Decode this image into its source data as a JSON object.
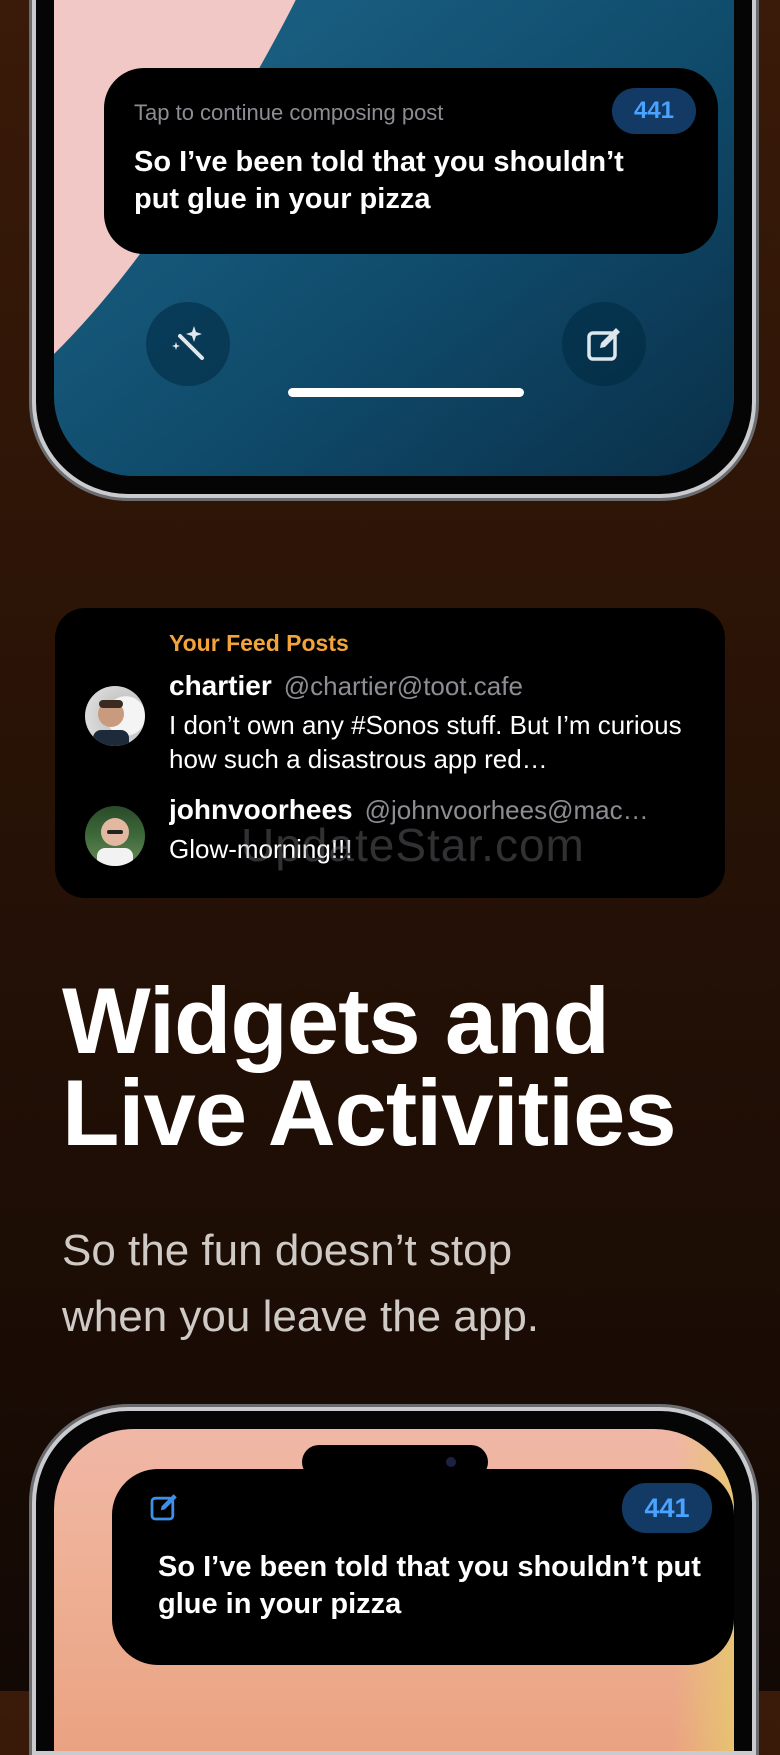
{
  "colors": {
    "background_top": "#3a1a08",
    "background_bottom": "#120804",
    "accent_orange": "#f2a33a",
    "badge_text": "#4aa3ff",
    "badge_bg": "#123a64"
  },
  "live_activity_top": {
    "hint": "Tap to continue composing post",
    "count": "441",
    "text": "So I’ve been told that you shouldn’t put glue in your pizza",
    "left_button_icon": "magic-wand-icon",
    "right_button_icon": "compose-icon"
  },
  "feed_widget": {
    "title": "Your Feed Posts",
    "posts": [
      {
        "name": "chartier",
        "handle": "@chartier@toot.cafe",
        "body": "I don’t own any #Sonos stuff. But I’m curious how such a disastrous app red…"
      },
      {
        "name": "johnvoorhees",
        "handle": "@johnvoorhees@mac…",
        "body": "Glow-morning!!!"
      }
    ],
    "watermark": "UpdateStar.com"
  },
  "headline": {
    "line1": "Widgets and",
    "line2": "Live Activities"
  },
  "subhead": {
    "line1": "So the fun doesn’t stop",
    "line2": "when you leave the app."
  },
  "live_activity_bottom": {
    "icon": "compose-icon",
    "count": "441",
    "text": "So I’ve been told that you shouldn’t put glue in your pizza"
  }
}
